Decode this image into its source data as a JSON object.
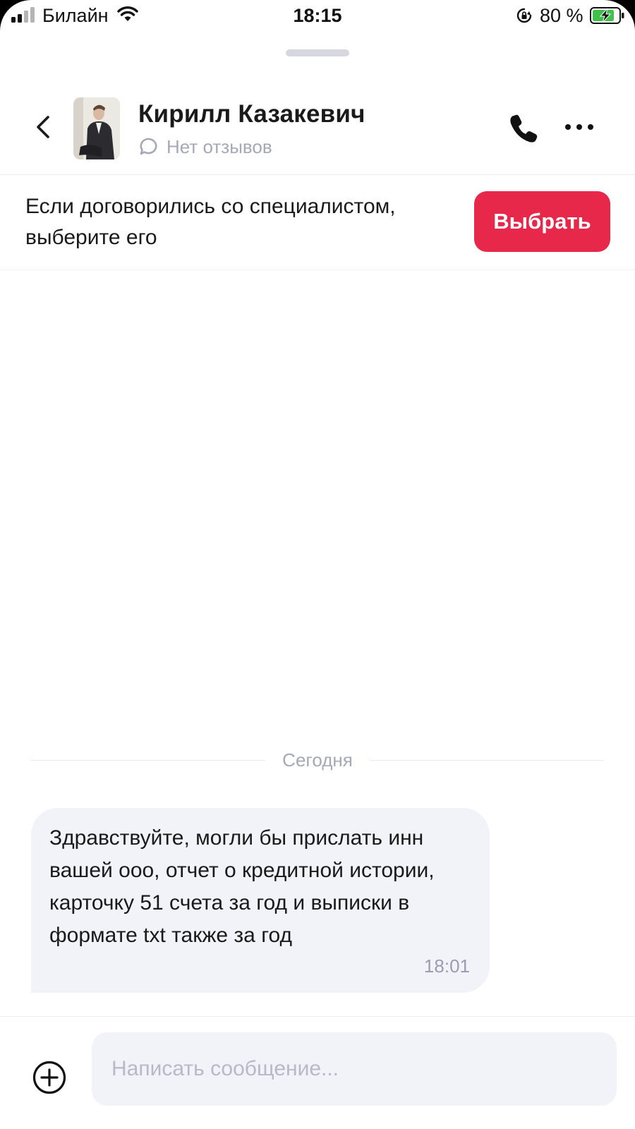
{
  "status_bar": {
    "carrier": "Билайн",
    "time": "18:15",
    "battery": "80 %"
  },
  "header": {
    "name": "Кирилл Казакевич",
    "reviews": "Нет отзывов"
  },
  "banner": {
    "text": "Если договорились со специалистом, выберите его",
    "button": "Выбрать"
  },
  "chat": {
    "date_separator": "Сегодня",
    "messages": [
      {
        "text": "Здравствуйте, могли бы прислать инн вашей ооо, отчет о кредитной истории, карточку 51 счета за год и выписки в формате txt также за год",
        "time": "18:01"
      }
    ]
  },
  "composer": {
    "placeholder": "Написать сообщение..."
  },
  "colors": {
    "accent": "#e8284a",
    "muted_text": "#a6a8b8",
    "bubble_bg": "#f2f3f8",
    "battery_green": "#3fc14b"
  },
  "icons": [
    "signal-icon",
    "wifi-icon",
    "rotation-lock-icon",
    "battery-icon",
    "back-icon",
    "chat-bubble-icon",
    "phone-icon",
    "more-icon",
    "plus-circle-icon"
  ]
}
